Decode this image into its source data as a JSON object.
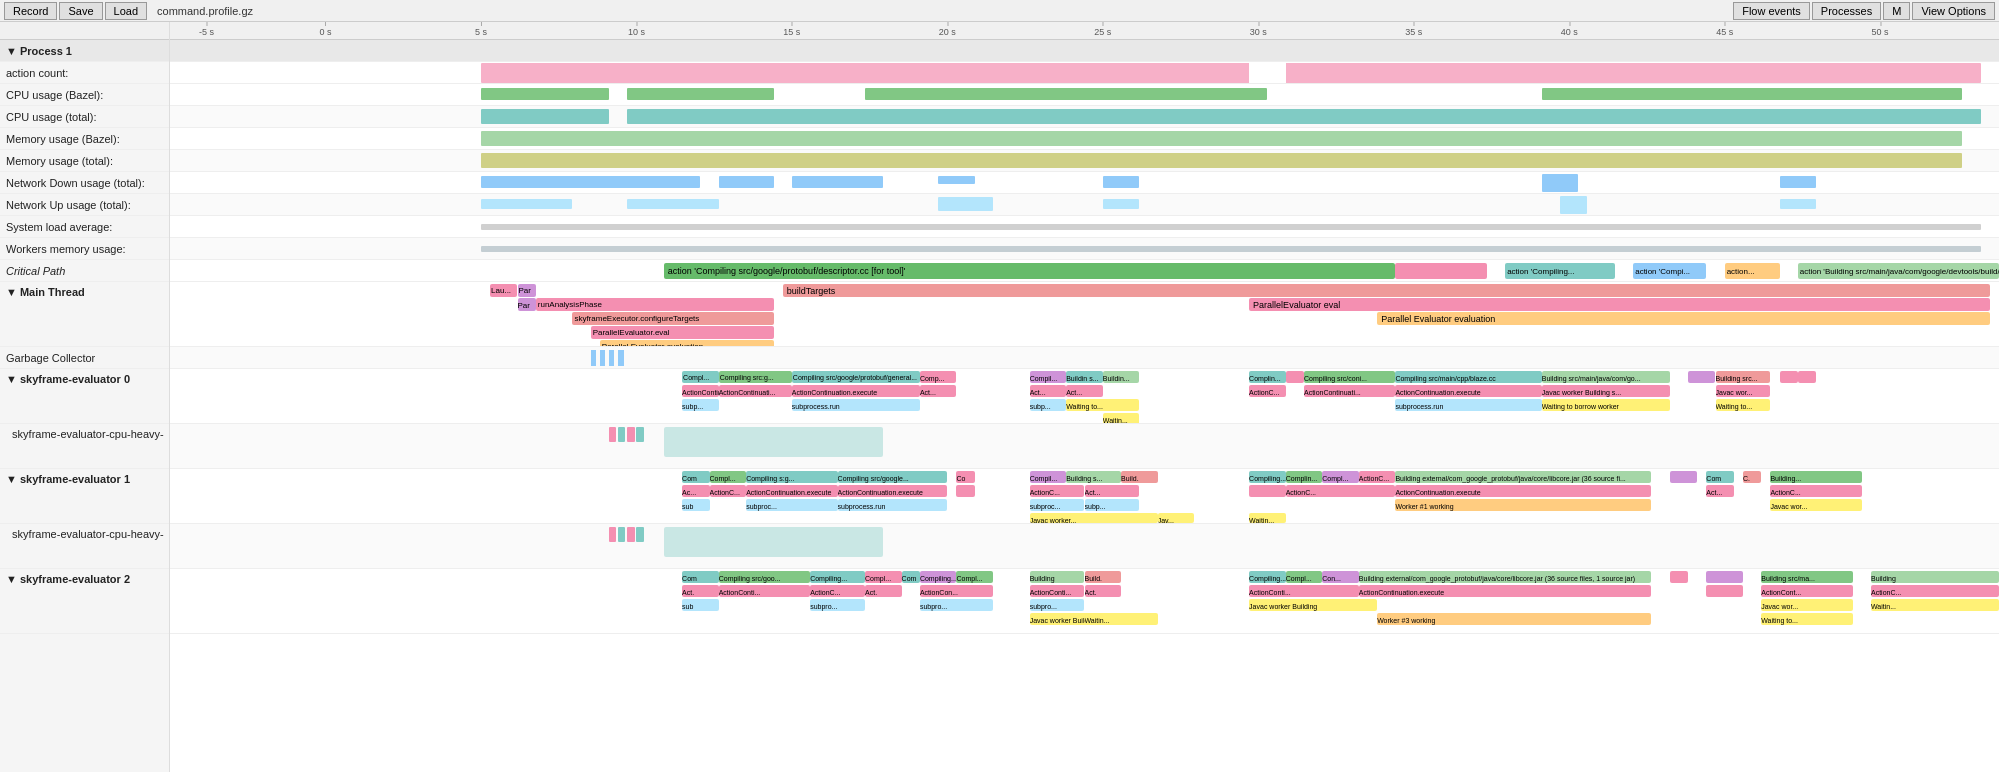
{
  "toolbar": {
    "record_label": "Record",
    "save_label": "Save",
    "load_label": "Load",
    "filename": "command.profile.gz",
    "flow_events_label": "Flow events",
    "processes_label": "Processes",
    "m_label": "M",
    "view_options_label": "View Options"
  },
  "time_marks": [
    {
      "label": "-5 s",
      "pct": 2
    },
    {
      "label": "0 s",
      "pct": 8.5
    },
    {
      "label": "5 s",
      "pct": 17
    },
    {
      "label": "10 s",
      "pct": 25.5
    },
    {
      "label": "15 s",
      "pct": 34
    },
    {
      "label": "20 s",
      "pct": 42.5
    },
    {
      "label": "25 s",
      "pct": 51
    },
    {
      "label": "30 s",
      "pct": 59.5
    },
    {
      "label": "35 s",
      "pct": 68
    },
    {
      "label": "40 s",
      "pct": 76.5
    },
    {
      "label": "45 s",
      "pct": 85
    },
    {
      "label": "50 s",
      "pct": 93.5
    }
  ],
  "rows": [
    {
      "label": "▼ Process 1",
      "type": "section-header",
      "height": "22"
    },
    {
      "label": "action count:",
      "height": "22"
    },
    {
      "label": "CPU usage (Bazel):",
      "height": "22"
    },
    {
      "label": "CPU usage (total):",
      "height": "22"
    },
    {
      "label": "Memory usage (Bazel):",
      "height": "22"
    },
    {
      "label": "Memory usage (total):",
      "height": "22"
    },
    {
      "label": "Network Down usage (total):",
      "height": "22"
    },
    {
      "label": "Network Up usage (total):",
      "height": "22"
    },
    {
      "label": "System load average:",
      "height": "22"
    },
    {
      "label": "Workers memory usage:",
      "height": "22"
    },
    {
      "label": "Critical Path",
      "height": "22"
    },
    {
      "label": "▼ Main Thread",
      "height": "h65"
    },
    {
      "label": "Garbage Collector",
      "height": "22"
    },
    {
      "label": "▼ skyframe-evaluator 0",
      "height": "h55"
    },
    {
      "label": "skyframe-evaluator-cpu-heavy-",
      "height": "h45"
    },
    {
      "label": "▼ skyframe-evaluator 1",
      "height": "h55"
    },
    {
      "label": "skyframe-evaluator-cpu-heavy-",
      "height": "h45"
    },
    {
      "label": "▼ skyframe-evaluator 2",
      "height": "h65"
    }
  ],
  "colors": {
    "pink": "#f48fb1",
    "green": "#81c784",
    "teal": "#80cbc4",
    "blue": "#90caf9",
    "light_blue": "#b3e5fc",
    "olive": "#c5c66a",
    "gray": "#bdbdbd",
    "salmon": "#ef9a9a",
    "purple": "#ce93d8",
    "orange": "#ffcc80",
    "yellow": "#fff176",
    "dark_green": "#66bb6a",
    "mid_green": "#a5d6a7"
  }
}
